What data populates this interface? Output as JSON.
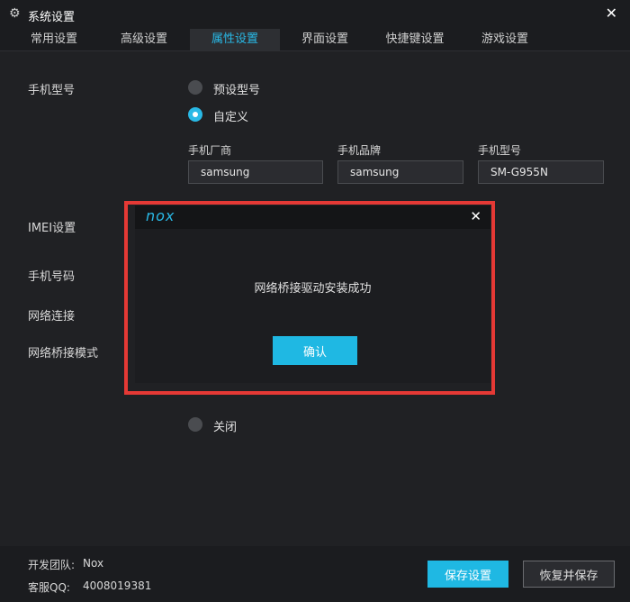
{
  "window": {
    "title": "系统设置",
    "icon": "gear-icon",
    "close_icon": "close-icon"
  },
  "tabs": [
    {
      "label": "常用设置",
      "active": false
    },
    {
      "label": "高级设置",
      "active": false
    },
    {
      "label": "属性设置",
      "active": true
    },
    {
      "label": "界面设置",
      "active": false
    },
    {
      "label": "快捷键设置",
      "active": false
    },
    {
      "label": "游戏设置",
      "active": false
    }
  ],
  "phone_model": {
    "label": "手机型号",
    "options": [
      {
        "label": "预设型号",
        "checked": false
      },
      {
        "label": "自定义",
        "checked": true
      }
    ],
    "fields": [
      {
        "label": "手机厂商",
        "value": "samsung"
      },
      {
        "label": "手机品牌",
        "value": "samsung"
      },
      {
        "label": "手机型号",
        "value": "SM-G955N"
      }
    ]
  },
  "sections": {
    "imei": "IMEI设置",
    "phone_number": "手机号码",
    "network": "网络连接",
    "bridge_mode": "网络桥接模式"
  },
  "bridge_off_option": {
    "label": "关闭",
    "checked": false
  },
  "modal": {
    "logo": "nox",
    "message": "网络桥接驱动安装成功",
    "confirm_label": "确认",
    "close_icon": "close-icon",
    "highlight_color": "#e53935"
  },
  "footer": {
    "team_label": "开发团队:",
    "team_value": "Nox",
    "qq_label": "客服QQ:",
    "qq_value": "4008019381",
    "save_label": "保存设置",
    "restore_label": "恢复并保存"
  },
  "colors": {
    "accent": "#1fb8e3",
    "background": "#202124"
  }
}
